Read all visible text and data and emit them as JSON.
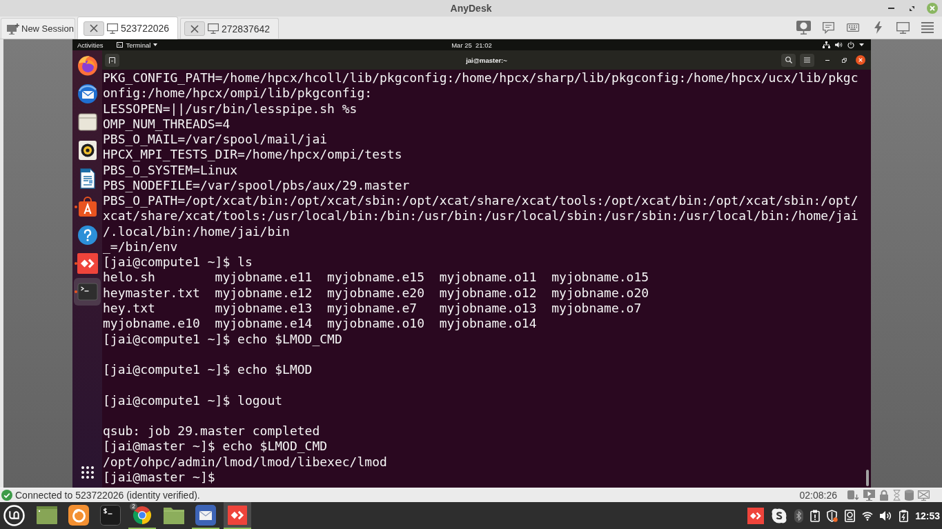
{
  "window": {
    "title": "AnyDesk"
  },
  "new_session": {
    "label": "New Session"
  },
  "tabs": [
    {
      "label": "523722026",
      "selected": true
    },
    {
      "label": "272837642",
      "selected": false
    }
  ],
  "remote": {
    "top_bar": {
      "activities": "Activities",
      "app_menu": "Terminal",
      "clock": "Mar 25  21:02"
    },
    "dock": [
      {
        "kind": "browser",
        "running": false,
        "selected": false
      },
      {
        "kind": "mail",
        "running": false,
        "selected": false
      },
      {
        "kind": "files",
        "running": false,
        "selected": false
      },
      {
        "kind": "music",
        "running": false,
        "selected": false
      },
      {
        "kind": "document",
        "running": false,
        "selected": false
      },
      {
        "kind": "store",
        "running": true,
        "selected": false
      },
      {
        "kind": "help",
        "running": false,
        "selected": false
      },
      {
        "kind": "remote",
        "running": true,
        "selected": false
      },
      {
        "kind": "terminal",
        "running": true,
        "selected": true
      }
    ],
    "terminal": {
      "title": "jai@master:~",
      "lines": [
        {
          "kind": "text",
          "text": "PKG_CONFIG_PATH=/home/hpcx/hcoll/lib/pkgconfig:/home/hpcx/sharp/lib/pkgconfig:/home/hpcx/ucx/lib/pkgc"
        },
        {
          "kind": "text",
          "text": "onfig:/home/hpcx/ompi/lib/pkgconfig:"
        },
        {
          "kind": "text",
          "text": "LESSOPEN=||/usr/bin/lesspipe.sh %s"
        },
        {
          "kind": "text",
          "text": "OMP_NUM_THREADS=4"
        },
        {
          "kind": "text",
          "text": "PBS_O_MAIL=/var/spool/mail/jai"
        },
        {
          "kind": "text",
          "text": "HPCX_MPI_TESTS_DIR=/home/hpcx/ompi/tests"
        },
        {
          "kind": "text",
          "text": "PBS_O_SYSTEM=Linux"
        },
        {
          "kind": "text",
          "text": "PBS_NODEFILE=/var/spool/pbs/aux/29.master"
        },
        {
          "kind": "text",
          "text": "PBS_O_PATH=/opt/xcat/bin:/opt/xcat/sbin:/opt/xcat/share/xcat/tools:/opt/xcat/bin:/opt/xcat/sbin:/opt/"
        },
        {
          "kind": "text",
          "text": "xcat/share/xcat/tools:/usr/local/bin:/bin:/usr/bin:/usr/local/sbin:/usr/sbin:/usr/local/bin:/home/jai"
        },
        {
          "kind": "text",
          "text": "/.local/bin:/home/jai/bin"
        },
        {
          "kind": "text",
          "text": "_=/bin/env"
        },
        {
          "kind": "text",
          "text": "[jai@compute1 ~]$ ls"
        },
        {
          "kind": "text",
          "text": "helo.sh        myjobname.e11  myjobname.e15  myjobname.o11  myjobname.o15"
        },
        {
          "kind": "text",
          "text": "heymaster.txt  myjobname.e12  myjobname.e20  myjobname.o12  myjobname.o20"
        },
        {
          "kind": "text",
          "text": "hey.txt        myjobname.e13  myjobname.e7   myjobname.o13  myjobname.o7"
        },
        {
          "kind": "text",
          "text": "myjobname.e10  myjobname.e14  myjobname.o10  myjobname.o14"
        },
        {
          "kind": "text",
          "text": "[jai@compute1 ~]$ echo $LMOD_CMD"
        },
        {
          "kind": "blank"
        },
        {
          "kind": "text",
          "text": "[jai@compute1 ~]$ echo $LMOD"
        },
        {
          "kind": "blank"
        },
        {
          "kind": "text",
          "text": "[jai@compute1 ~]$ logout"
        },
        {
          "kind": "blank"
        },
        {
          "kind": "text",
          "text": "qsub: job 29.master completed"
        },
        {
          "kind": "text",
          "text": "[jai@master ~]$ echo $LMOD_CMD"
        },
        {
          "kind": "text",
          "text": "/opt/ohpc/admin/lmod/lmod/libexec/lmod"
        },
        {
          "kind": "text",
          "text": "[jai@master ~]$"
        }
      ]
    }
  },
  "status_bar": {
    "message": "Connected to 523722026 (identity verified).",
    "timer": "02:08:26"
  },
  "taskbar": {
    "launchers": [
      {
        "kind": "desktop",
        "running": false,
        "selected": false
      },
      {
        "kind": "browser",
        "running": false,
        "selected": false
      },
      {
        "kind": "terminal",
        "running": false,
        "selected": false
      },
      {
        "kind": "web",
        "running": true,
        "selected": false,
        "badge": "2"
      },
      {
        "kind": "files",
        "running": false,
        "selected": false
      },
      {
        "kind": "mail",
        "running": true,
        "selected": false
      },
      {
        "kind": "remote",
        "running": true,
        "selected": true
      }
    ],
    "clock": "12:53"
  }
}
